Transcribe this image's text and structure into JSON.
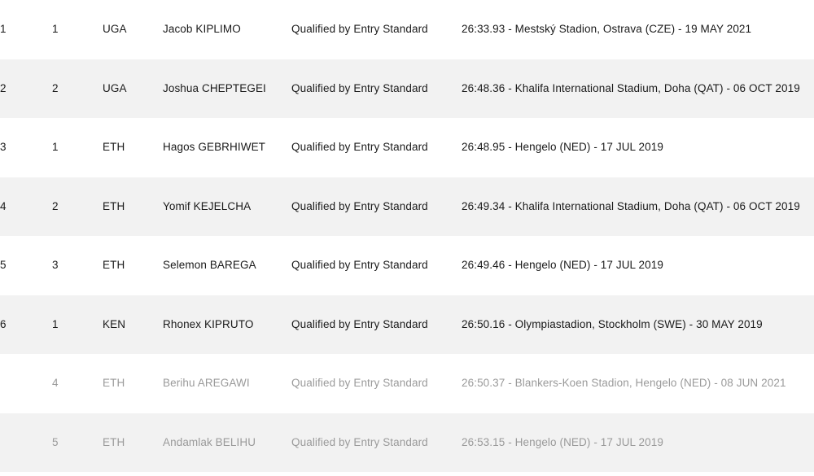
{
  "table": {
    "columns": [
      {
        "key": "place",
        "label": ""
      },
      {
        "key": "nat_pos",
        "label": ""
      },
      {
        "key": "country",
        "label": ""
      },
      {
        "key": "athlete",
        "label": ""
      },
      {
        "key": "status",
        "label": ""
      },
      {
        "key": "perf",
        "label": ""
      }
    ],
    "colors": {
      "row_odd_bg": "#ffffff",
      "row_even_bg": "#f2f2f2",
      "text": "#1a1a1a",
      "text_faded": "#9a9a9a"
    },
    "rows": [
      {
        "place": "1",
        "nat_pos": "1",
        "country": "UGA",
        "athlete": "Jacob KIPLIMO",
        "status": "Qualified by Entry Standard",
        "perf": "26:33.93 - Mestský Stadion, Ostrava (CZE) - 19 MAY 2021",
        "faded": false
      },
      {
        "place": "2",
        "nat_pos": "2",
        "country": "UGA",
        "athlete": "Joshua CHEPTEGEI",
        "status": "Qualified by Entry Standard",
        "perf": "26:48.36 - Khalifa International Stadium, Doha (QAT) - 06 OCT 2019",
        "faded": false
      },
      {
        "place": "3",
        "nat_pos": "1",
        "country": "ETH",
        "athlete": "Hagos GEBRHIWET",
        "status": "Qualified by Entry Standard",
        "perf": "26:48.95 - Hengelo (NED) - 17 JUL 2019",
        "faded": false
      },
      {
        "place": "4",
        "nat_pos": "2",
        "country": "ETH",
        "athlete": "Yomif KEJELCHA",
        "status": "Qualified by Entry Standard",
        "perf": "26:49.34 - Khalifa International Stadium, Doha (QAT) - 06 OCT 2019",
        "faded": false
      },
      {
        "place": "5",
        "nat_pos": "3",
        "country": "ETH",
        "athlete": "Selemon BAREGA",
        "status": "Qualified by Entry Standard",
        "perf": "26:49.46 - Hengelo (NED) - 17 JUL 2019",
        "faded": false
      },
      {
        "place": "6",
        "nat_pos": "1",
        "country": "KEN",
        "athlete": "Rhonex KIPRUTO",
        "status": "Qualified by Entry Standard",
        "perf": "26:50.16 - Olympiastadion, Stockholm (SWE) - 30 MAY 2019",
        "faded": false
      },
      {
        "place": "",
        "nat_pos": "4",
        "country": "ETH",
        "athlete": "Berihu AREGAWI",
        "status": "Qualified by Entry Standard",
        "perf": "26:50.37 - Blankers-Koen Stadion, Hengelo (NED) - 08 JUN 2021",
        "faded": true
      },
      {
        "place": "",
        "nat_pos": "5",
        "country": "ETH",
        "athlete": "Andamlak BELIHU",
        "status": "Qualified by Entry Standard",
        "perf": "26:53.15 - Hengelo (NED) - 17 JUL 2019",
        "faded": true
      }
    ]
  }
}
